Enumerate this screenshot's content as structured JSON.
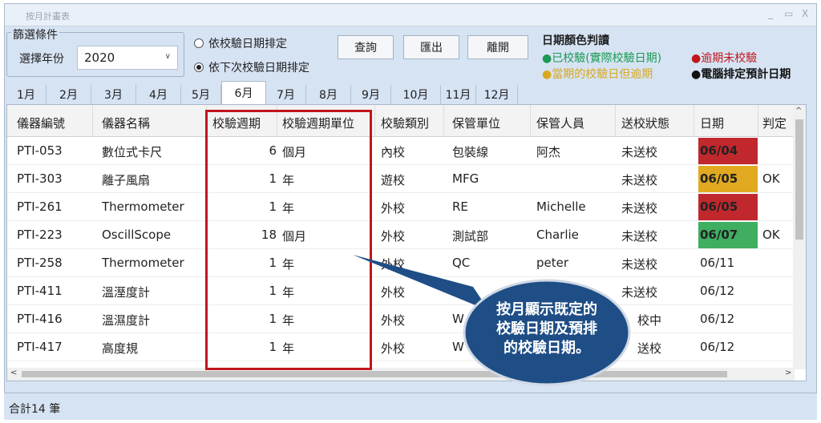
{
  "window": {
    "title": "按月計畫表",
    "controls": {
      "minimize": "_",
      "maximize": "▭",
      "close": "X"
    }
  },
  "filter": {
    "legend": "篩選條件",
    "year_label": "選擇年份",
    "year_value": "2020",
    "options": [
      {
        "label": "依校驗日期排定",
        "checked": false
      },
      {
        "label": "依下次校驗日期排定",
        "checked": true
      }
    ]
  },
  "toolbar": {
    "query_label": "查詢",
    "export_label": "匯出",
    "exit_label": "離開"
  },
  "color_legend": {
    "title": "日期顏色判讀",
    "items": [
      {
        "bullet": "●",
        "text": "已校驗(實際校驗日期)",
        "color": "#1a9a52"
      },
      {
        "bullet": "●",
        "text": "逾期未校驗",
        "color": "#c0161c"
      },
      {
        "bullet": "●",
        "text": "當期的校驗日但逾期",
        "color": "#d9a81e"
      },
      {
        "bullet": "●",
        "text": "電腦排定預計日期",
        "color": "#111111"
      }
    ]
  },
  "tabs": [
    "1月",
    "2月",
    "3月",
    "4月",
    "5月",
    "6月",
    "7月",
    "8月",
    "9月",
    "10月",
    "11月",
    "12月"
  ],
  "active_tab": "6月",
  "table": {
    "columns": [
      "儀器編號",
      "儀器名稱",
      "校驗週期",
      "校驗週期單位",
      "校驗類別",
      "保管單位",
      "保管人員",
      "送校狀態",
      "日期",
      "判定"
    ],
    "rows": [
      {
        "id": "PTI-053",
        "name": "數位式卡尺",
        "period": "6",
        "unit": "個月",
        "type": "內校",
        "dept": "包裝線",
        "keeper": "阿杰",
        "status": "未送校",
        "date": "06/04",
        "date_color": "#c0282d",
        "judge": ""
      },
      {
        "id": "PTI-303",
        "name": "離子風扇",
        "period": "1",
        "unit": "年",
        "type": "遊校",
        "dept": "MFG",
        "keeper": "",
        "status": "未送校",
        "date": "06/05",
        "date_color": "#e0a91f",
        "judge": "OK"
      },
      {
        "id": "PTI-261",
        "name": "Thermometer",
        "period": "1",
        "unit": "年",
        "type": "外校",
        "dept": "RE",
        "keeper": "Michelle",
        "status": "未送校",
        "date": "06/05",
        "date_color": "#c0282d",
        "judge": ""
      },
      {
        "id": "PTI-223",
        "name": "OscillScope",
        "period": "18",
        "unit": "個月",
        "type": "外校",
        "dept": "測試部",
        "keeper": "Charlie",
        "status": "未送校",
        "date": "06/07",
        "date_color": "#3fae61",
        "judge": "OK"
      },
      {
        "id": "PTI-258",
        "name": "Thermometer",
        "period": "1",
        "unit": "年",
        "type": "外校",
        "dept": "QC",
        "keeper": "peter",
        "status": "未送校",
        "date": "06/11",
        "date_color": "",
        "judge": ""
      },
      {
        "id": "PTI-411",
        "name": "溫溼度計",
        "period": "1",
        "unit": "年",
        "type": "外校",
        "dept": "",
        "keeper": "",
        "status": "未送校",
        "date": "06/12",
        "date_color": "",
        "judge": ""
      },
      {
        "id": "PTI-416",
        "name": "溫濕度計",
        "period": "1",
        "unit": "年",
        "type": "外校",
        "dept": "W",
        "keeper": "",
        "status": "校中",
        "date": "06/12",
        "date_color": "",
        "judge": ""
      },
      {
        "id": "PTI-417",
        "name": "高度規",
        "period": "1",
        "unit": "年",
        "type": "外校",
        "dept": "W",
        "keeper": "",
        "status": "送校",
        "date": "06/12",
        "date_color": "",
        "judge": ""
      }
    ]
  },
  "scroll": {
    "up": "^",
    "left": "<",
    "right": ">"
  },
  "status_bar": {
    "total": "合計14 筆"
  },
  "callout": {
    "lines": [
      "按月顯示既定的",
      "校驗日期及預排",
      "的校驗日期。"
    ],
    "color": "#1f4e86"
  }
}
